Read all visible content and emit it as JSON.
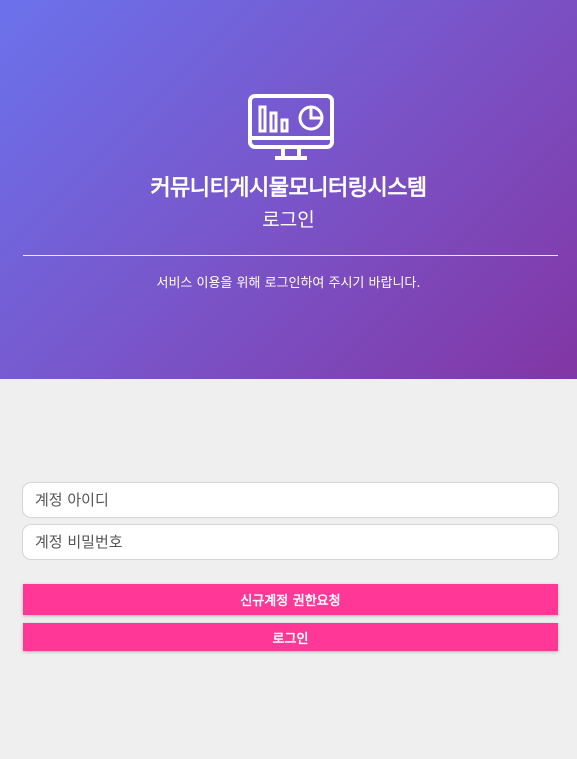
{
  "header": {
    "icon": "monitor-chart-icon",
    "title": "커뮤니티게시물모니터링시스템",
    "subtitle": "로그인",
    "message": "서비스 이용을 위해 로그인하여 주시기 바랍니다."
  },
  "form": {
    "id_placeholder": "계정 아이디",
    "password_placeholder": "계정 비밀번호"
  },
  "buttons": {
    "request_account": "신규계정 권한요청",
    "login": "로그인"
  },
  "colors": {
    "gradient_start": "#6b72ec",
    "gradient_end": "#8236a4",
    "accent": "#ff3796",
    "background": "#efefef"
  }
}
